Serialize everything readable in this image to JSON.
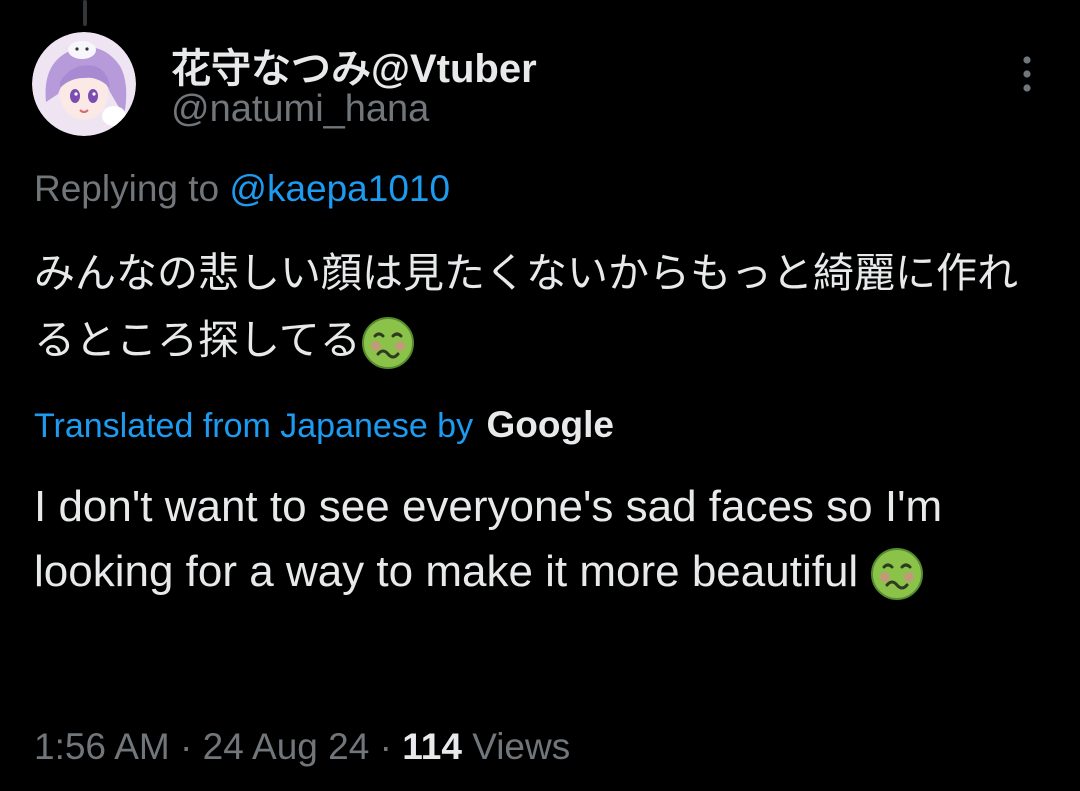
{
  "tweet": {
    "author": {
      "display_name": "花守なつみ@Vtuber",
      "handle": "@natumi_hana"
    },
    "replying_prefix": "Replying to",
    "replying_to": "@kaepa1010",
    "original_text": "みんなの悲しい顔は見たくないからもっと綺麗に作れるところ探してる",
    "emoji_name": "nauseated-face-icon",
    "translation_label": "Translated from Japanese by",
    "translation_provider": "Google",
    "translated_text": "I don't want to see everyone's sad faces so I'm looking for a way to make it more beautiful",
    "time": "1:56 AM",
    "date": "24 Aug 24",
    "separator": " · ",
    "views_count": "114",
    "views_label": "Views"
  },
  "colors": {
    "background": "#000000",
    "text": "#e7e9ea",
    "secondary": "#71767b",
    "accent": "#1d9bf0"
  }
}
